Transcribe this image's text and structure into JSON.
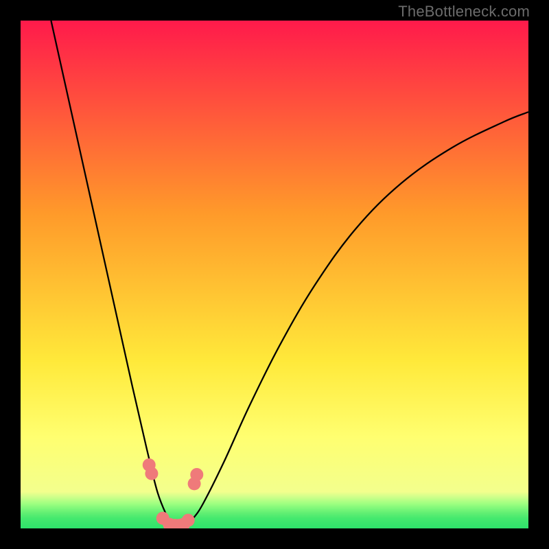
{
  "watermark": "TheBottleneck.com",
  "chart_data": {
    "type": "line",
    "title": "",
    "xlabel": "",
    "ylabel": "",
    "xlim": [
      0,
      100
    ],
    "ylim": [
      0,
      100
    ],
    "legend": false,
    "grid": false,
    "background_gradient": {
      "colors": [
        "#ff1a4b",
        "#ff9a2a",
        "#ffe93a",
        "#ffff70",
        "#2ee36b"
      ],
      "stops": [
        0,
        38,
        67,
        82,
        100
      ],
      "direction": "vertical"
    },
    "series": [
      {
        "name": "bottleneck-curve",
        "color": "#000000",
        "x": [
          6,
          10,
          14,
          18,
          22,
          25,
          27,
          29,
          30,
          31,
          32,
          34,
          36,
          40,
          45,
          51,
          58,
          66,
          75,
          85,
          95,
          100
        ],
        "y": [
          100,
          82,
          64,
          46,
          28,
          15,
          7,
          2,
          0,
          0,
          0,
          2,
          5,
          13,
          24,
          36,
          48,
          59,
          68,
          75,
          80,
          82
        ]
      },
      {
        "name": "markers",
        "color": "#ef7a7a",
        "type": "scatter",
        "x": [
          25.3,
          25.8,
          28.0,
          29.3,
          30.4,
          31.3,
          32.1,
          33.0,
          34.2,
          34.7
        ],
        "y": [
          12.5,
          10.8,
          2.0,
          0.8,
          0.6,
          0.6,
          0.8,
          1.6,
          8.8,
          10.6
        ]
      }
    ],
    "annotations": []
  },
  "colors": {
    "marker": "#ef7a7a",
    "curve": "#000000",
    "frame": "#000000"
  }
}
